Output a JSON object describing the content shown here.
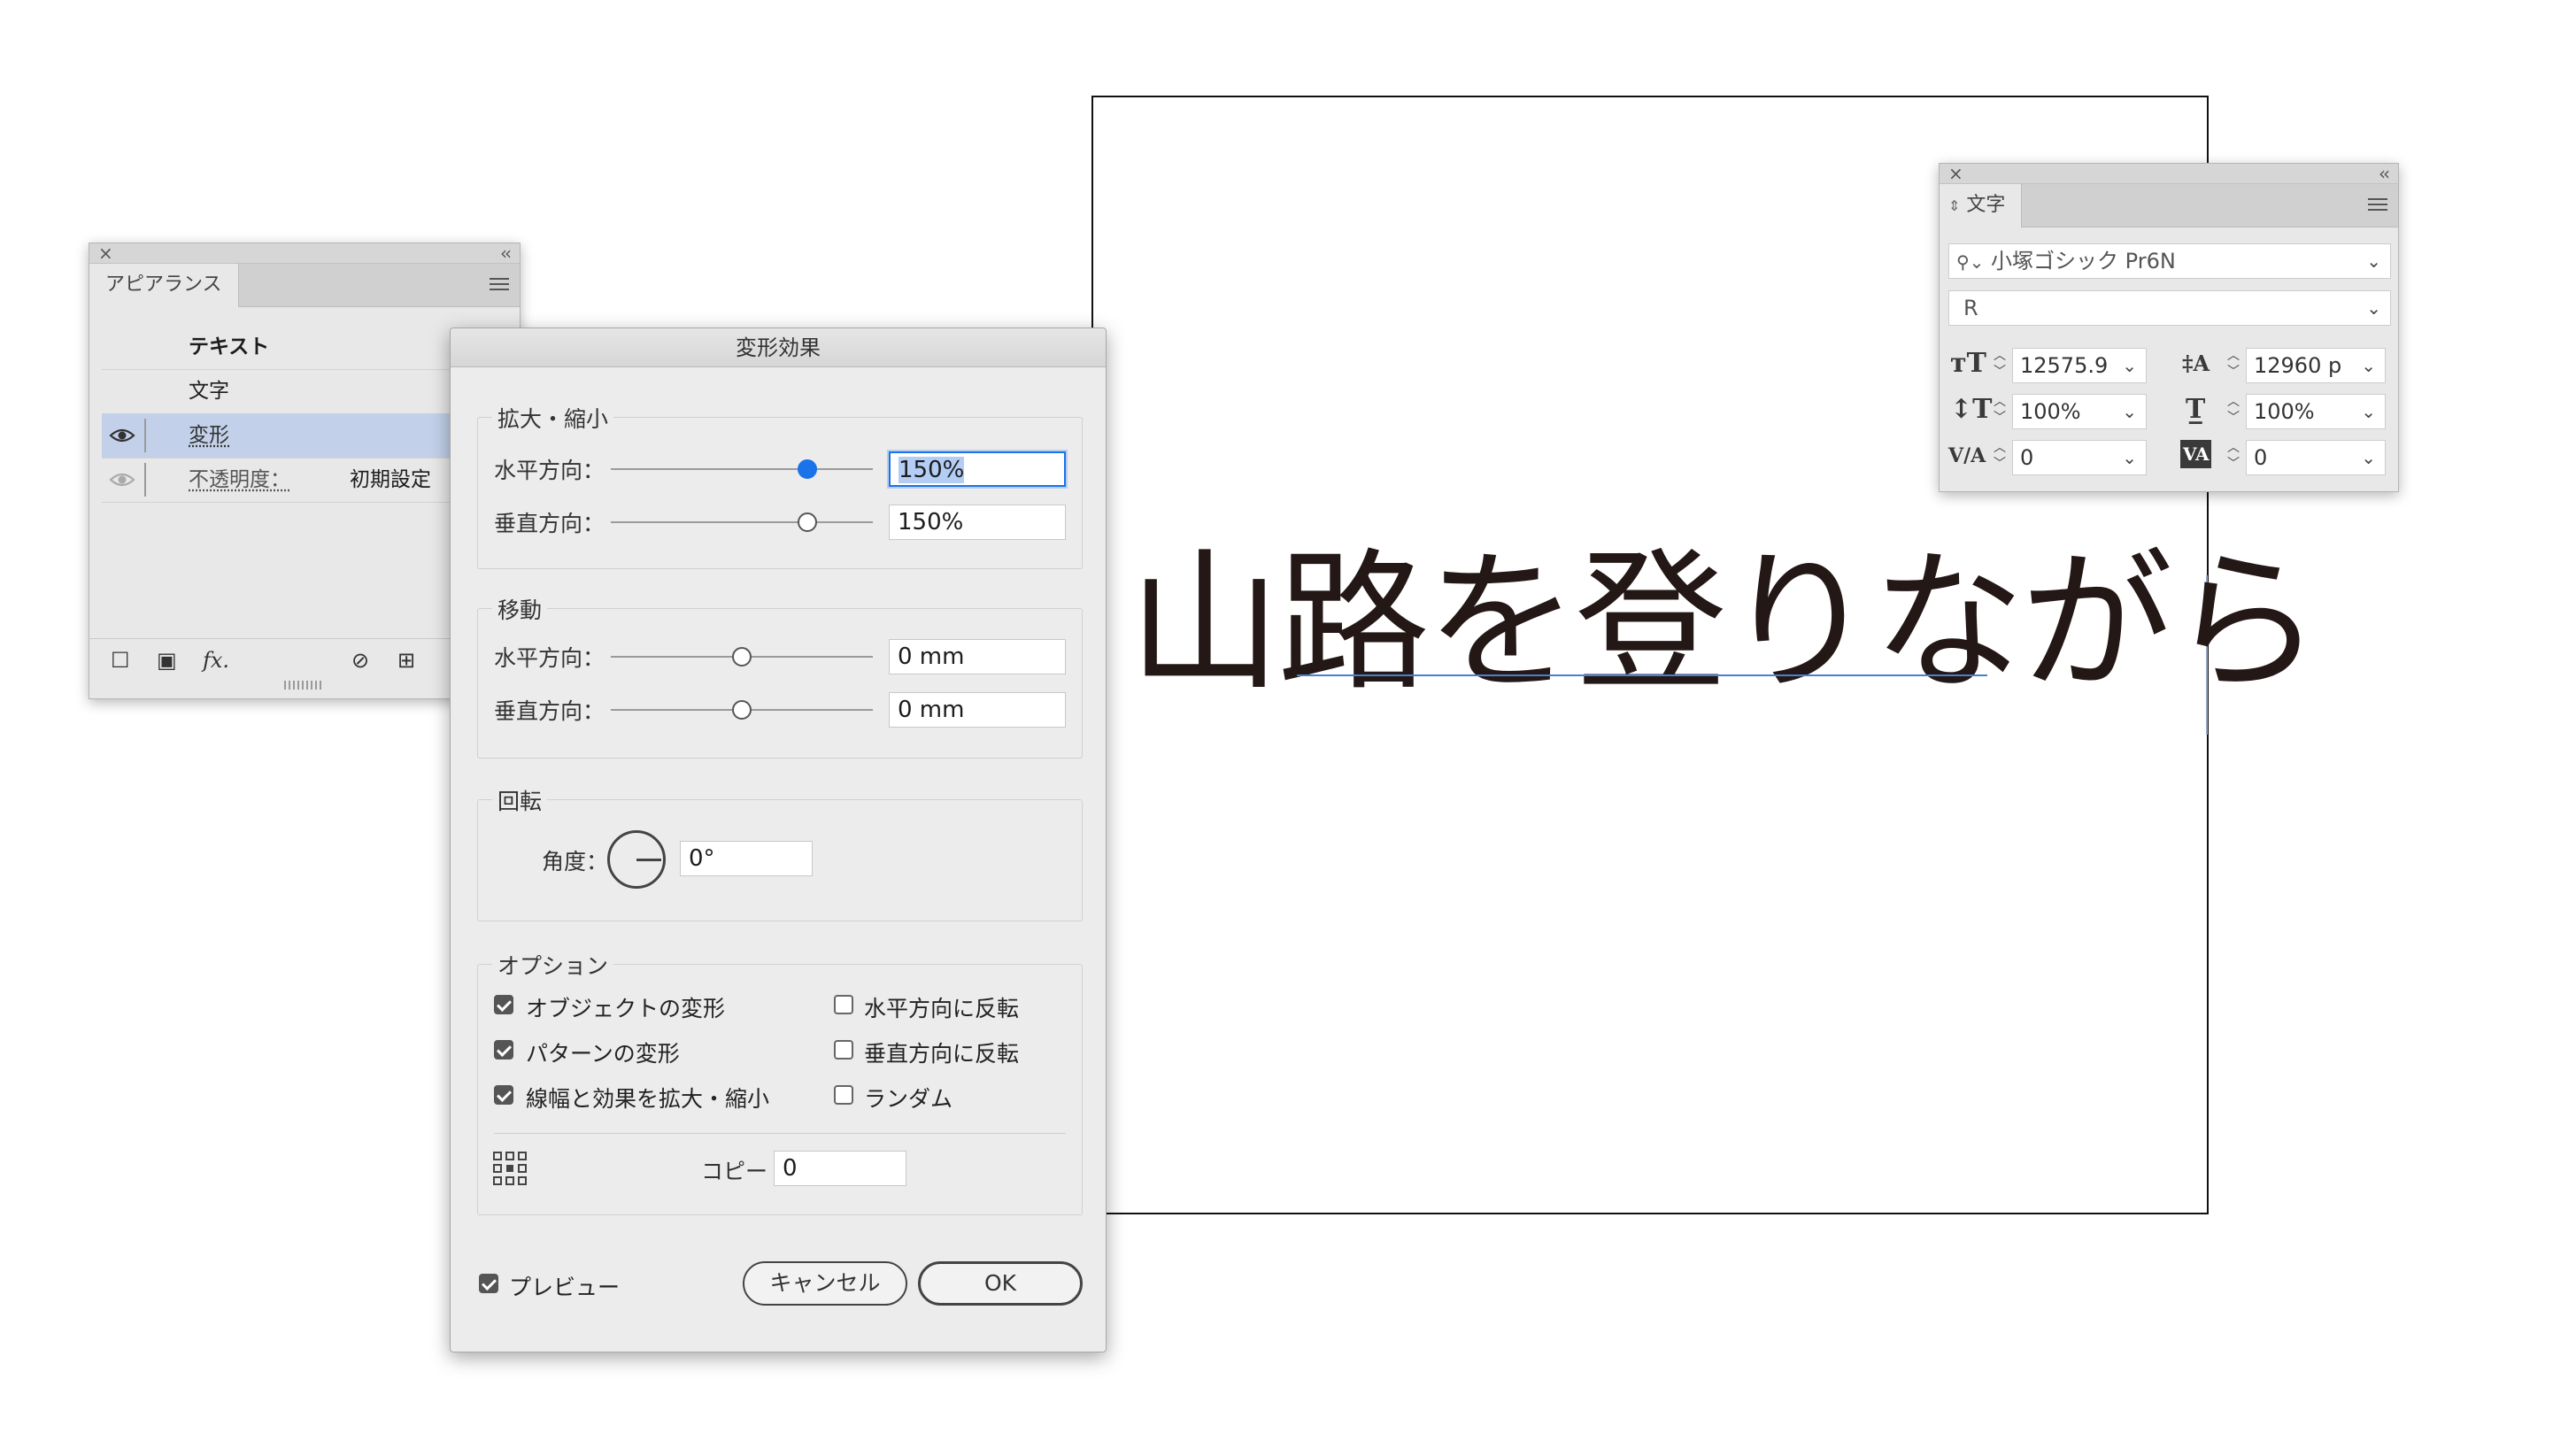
{
  "canvas": {
    "sample_text": "山路を登りながら"
  },
  "appearance_panel": {
    "tab": "アピアランス",
    "rows": [
      {
        "label": "テキスト",
        "value": ""
      },
      {
        "label": "文字",
        "value": ""
      },
      {
        "label": "変形",
        "value": ""
      },
      {
        "label": "不透明度：",
        "value": "初期設定"
      }
    ],
    "bottom_icons": [
      "new-stroke-icon",
      "new-fill-icon",
      "fx-icon",
      "clear-icon",
      "duplicate-icon"
    ],
    "fx_label": "fx."
  },
  "transform_dialog": {
    "title": "変形効果",
    "scale": {
      "title": "拡大・縮小",
      "horizontal_label": "水平方向：",
      "horizontal_value": "150%",
      "horizontal_slider": 0.75,
      "vertical_label": "垂直方向：",
      "vertical_value": "150%",
      "vertical_slider": 0.75
    },
    "move": {
      "title": "移動",
      "horizontal_label": "水平方向：",
      "horizontal_value": "0 mm",
      "vertical_label": "垂直方向：",
      "vertical_value": "0 mm"
    },
    "rotate": {
      "title": "回転",
      "angle_label": "角度：",
      "angle_value": "0°"
    },
    "options": {
      "title": "オプション",
      "transform_objects": {
        "label": "オブジェクトの変形",
        "checked": true
      },
      "transform_patterns": {
        "label": "パターンの変形",
        "checked": true
      },
      "scale_strokes": {
        "label": "線幅と効果を拡大・縮小",
        "checked": true
      },
      "reflect_x": {
        "label": "水平方向に反転",
        "checked": false
      },
      "reflect_y": {
        "label": "垂直方向に反転",
        "checked": false
      },
      "random": {
        "label": "ランダム",
        "checked": false
      },
      "copies_label": "コピー",
      "copies_value": "0"
    },
    "preview": {
      "label": "プレビュー",
      "checked": true
    },
    "cancel_label": "キャンセル",
    "ok_label": "OK"
  },
  "character_panel": {
    "tab": "文字",
    "font_family": "小塚ゴシック Pr6N",
    "font_style": "R",
    "font_size": "12575.9",
    "leading": "12960 p",
    "vertical_scale": "100%",
    "horizontal_scale": "100%",
    "kerning": "0",
    "tracking": "0"
  }
}
